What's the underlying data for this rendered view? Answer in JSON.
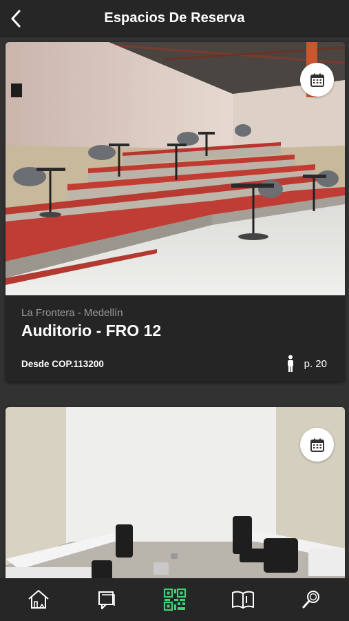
{
  "header": {
    "title": "Espacios De Reserva",
    "back_icon": "chevron-left-icon"
  },
  "spaces": [
    {
      "location": "La Frontera - Medellín",
      "name": "Auditorio - FRO 12",
      "price": "Desde COP.113200",
      "capacity": "p. 20",
      "calendar_icon": "calendar-icon",
      "person_icon": "person-icon"
    },
    {
      "calendar_icon": "calendar-icon"
    }
  ],
  "bottom_nav": {
    "items": [
      {
        "icon": "home-icon"
      },
      {
        "icon": "chat-icon"
      },
      {
        "icon": "qr-code-icon",
        "active": true
      },
      {
        "icon": "book-icon"
      },
      {
        "icon": "search-icon"
      }
    ],
    "active_color": "#3fd07a",
    "inactive_color": "#ffffff"
  },
  "colors": {
    "background": "#323232",
    "header": "#262626",
    "card": "#252525",
    "muted_text": "#9a9a9a"
  }
}
